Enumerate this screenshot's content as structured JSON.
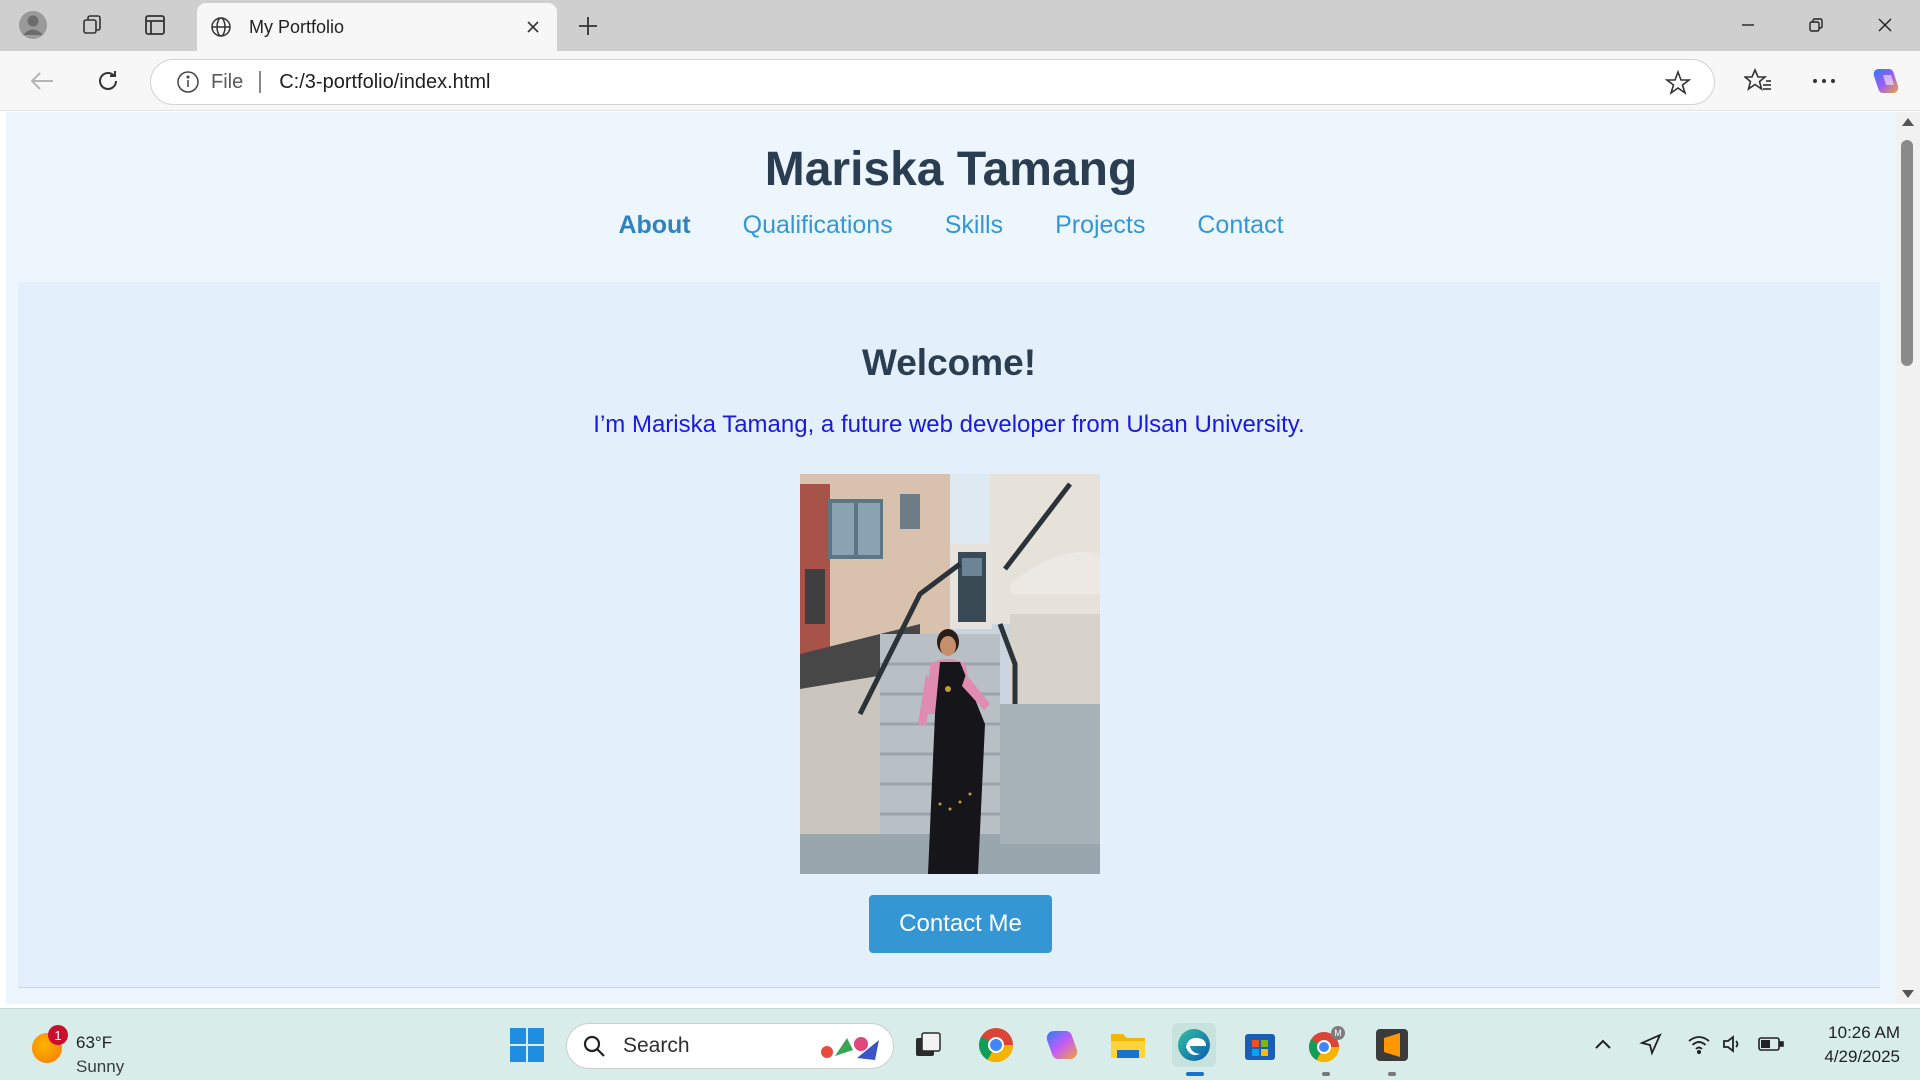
{
  "browser": {
    "tab_title": "My Portfolio",
    "address_scheme": "File",
    "address_url": "C:/3-portfolio/index.html"
  },
  "site": {
    "title": "Mariska Tamang",
    "nav": [
      {
        "label": "About",
        "active": true
      },
      {
        "label": "Qualifications",
        "active": false
      },
      {
        "label": "Skills",
        "active": false
      },
      {
        "label": "Projects",
        "active": false
      },
      {
        "label": "Contact",
        "active": false
      }
    ],
    "hero": {
      "heading": "Welcome!",
      "intro": "I’m Mariska Tamang, a future web developer from Ulsan University.",
      "button": "Contact Me"
    }
  },
  "taskbar": {
    "weather_temp": "63°F",
    "weather_condition": "Sunny",
    "weather_badge": "1",
    "search_label": "Search",
    "time": "10:26 AM",
    "date": "4/29/2025"
  },
  "colors": {
    "accent": "#3596d4",
    "title_text": "#2b3d50",
    "intro_text": "#1a1adb",
    "page_bg": "#eef6fd",
    "hero_bg": "#e3f0fc"
  },
  "icons": [
    "profile-icon",
    "workspaces-icon",
    "tab-actions-icon",
    "globe-icon",
    "close-icon",
    "new-tab-icon",
    "minimize-icon",
    "restore-icon",
    "window-close-icon",
    "back-icon",
    "refresh-icon",
    "info-icon",
    "favorite-star-icon",
    "favorites-icon",
    "more-icon",
    "copilot-icon",
    "windows-start-icon",
    "search-icon",
    "task-view-icon",
    "chrome-icon",
    "copilot-app-icon",
    "file-explorer-icon",
    "edge-icon",
    "store-icon",
    "chrome-profile-icon",
    "sublime-icon",
    "chevron-up-icon",
    "location-icon",
    "wifi-icon",
    "volume-icon",
    "battery-icon"
  ]
}
